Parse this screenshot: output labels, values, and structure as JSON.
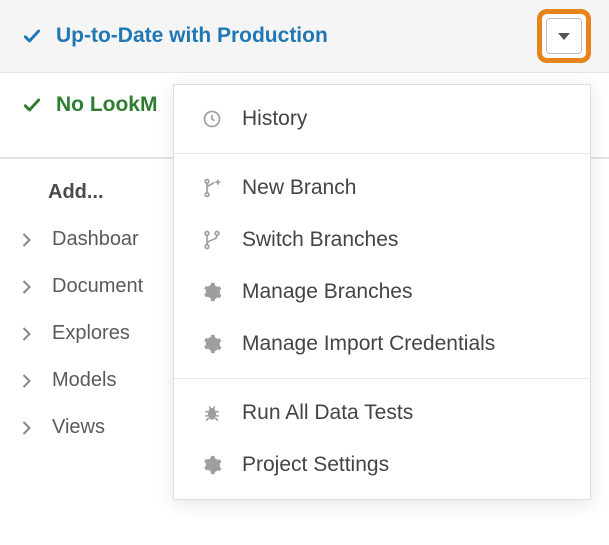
{
  "status": {
    "production_label": "Up-to-Date with Production",
    "lookml_label_visible_prefix": "No LookM"
  },
  "add": {
    "title": "Add..."
  },
  "tree": {
    "items": [
      {
        "label_visible": "Dashboar"
      },
      {
        "label_visible": "Document"
      },
      {
        "label_visible": "Explores"
      },
      {
        "label_visible": "Models"
      },
      {
        "label_visible": "Views"
      }
    ]
  },
  "dropdown": {
    "groups": [
      {
        "items": [
          {
            "icon": "clock-icon",
            "label": "History"
          }
        ]
      },
      {
        "items": [
          {
            "icon": "branch-new-icon",
            "label": "New Branch"
          },
          {
            "icon": "branch-icon",
            "label": "Switch Branches"
          },
          {
            "icon": "gear-icon",
            "label": "Manage Branches"
          },
          {
            "icon": "gear-icon",
            "label": "Manage Import Credentials"
          }
        ]
      },
      {
        "items": [
          {
            "icon": "bug-icon",
            "label": "Run All Data Tests"
          },
          {
            "icon": "gear-icon",
            "label": "Project Settings"
          }
        ]
      }
    ]
  }
}
